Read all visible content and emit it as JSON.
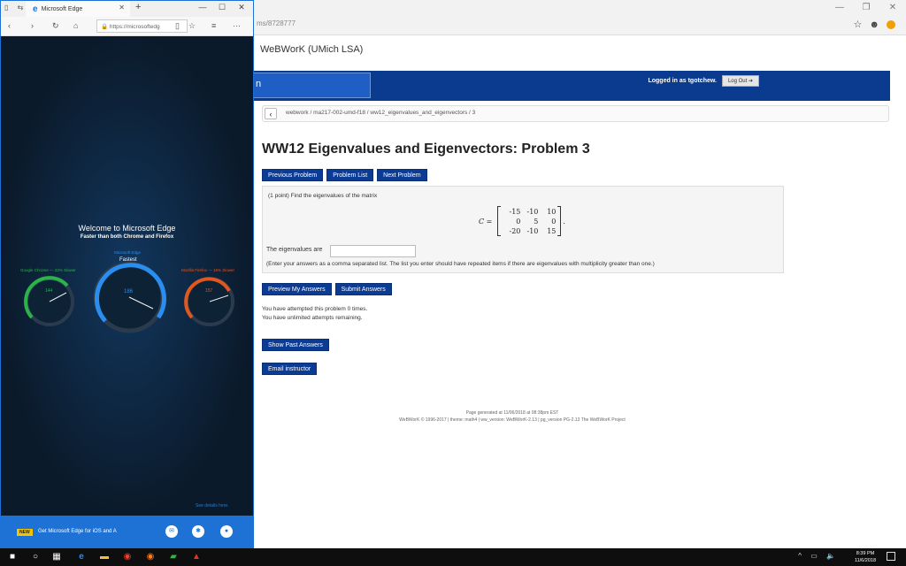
{
  "bg_browser": {
    "url_fragment": "ms/8728777",
    "page_header": "WeBWorK (UMich LSA)",
    "banner_box_text": "n",
    "logged_in": "Logged in as tgotchew.",
    "logout": "Log Out",
    "breadcrumb": "webwork / ma217-002-umd-f18 / ww12_eigenvalues_and_eigenvectors / 3",
    "problem_title": "WW12 Eigenvalues and Eigenvectors: Problem 3",
    "nav_buttons": [
      "Previous Problem",
      "Problem List",
      "Next Problem"
    ],
    "problem_intro": "(1 point) Find the eigenvalues of the matrix",
    "matrix_label": "C =",
    "matrix": [
      "-15",
      "-10",
      "10",
      "0",
      "5",
      "0",
      "-20",
      "-10",
      "15"
    ],
    "eig_label": "The eigenvalues are",
    "eig_value": "",
    "eig_hint": "(Enter your answers as a comma separated list. The list you enter should have repeated items if there are eigenvalues with multiplicity greater than one.)",
    "preview_btn": "Preview My Answers",
    "submit_btn": "Submit Answers",
    "attempts_1": "You have attempted this problem 0 times.",
    "attempts_2": "You have unlimited attempts remaining.",
    "show_past": "Show Past Answers",
    "email_instructor": "Email instructor",
    "footer_1": "Page generated at 11/06/2018 at 08:38pm EST",
    "footer_2": "WeBWorK © 1996-2017 | theme: math4 | ww_version: WeBWorK-2.13 | pg_version PG-2.13 The WeBWorK Project"
  },
  "edge": {
    "tab_title": "Microsoft Edge",
    "url": "https://microsoftedg",
    "welcome": "Welcome to Microsoft Edge",
    "tagline": "Faster than both Chrome and Firefox",
    "chrome_label": "Google Chrome — 23% Slower",
    "edge_label_top": "Microsoft Edge",
    "edge_label": "Fastest",
    "firefox_label": "Mozilla Firefox — 16% Slower",
    "gauge_chrome": "144",
    "gauge_edge": "186",
    "gauge_firefox": "157",
    "see_details": "See details here.",
    "new_badge": "NEW",
    "get_edge": "Get Microsoft Edge for iOS and A"
  },
  "taskbar": {
    "time": "8:39 PM",
    "date": "11/6/2018"
  },
  "colors": {
    "webwork_blue": "#0b3b93",
    "edge_blue": "#1e72d6",
    "edge_dark": "#0b1a2b"
  }
}
